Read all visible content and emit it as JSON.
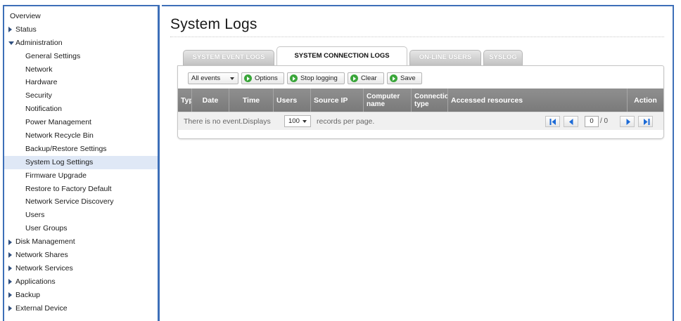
{
  "sidebar": {
    "items": [
      {
        "label": "Overview"
      },
      {
        "label": "Status"
      },
      {
        "label": "Administration"
      },
      {
        "label": "General Settings"
      },
      {
        "label": "Network"
      },
      {
        "label": "Hardware"
      },
      {
        "label": "Security"
      },
      {
        "label": "Notification"
      },
      {
        "label": "Power Management"
      },
      {
        "label": "Network Recycle Bin"
      },
      {
        "label": "Backup/Restore Settings"
      },
      {
        "label": "System Log Settings"
      },
      {
        "label": "Firmware Upgrade"
      },
      {
        "label": "Restore to Factory Default"
      },
      {
        "label": "Network Service Discovery"
      },
      {
        "label": "Users"
      },
      {
        "label": "User Groups"
      },
      {
        "label": "Disk Management"
      },
      {
        "label": "Network Shares"
      },
      {
        "label": "Network Services"
      },
      {
        "label": "Applications"
      },
      {
        "label": "Backup"
      },
      {
        "label": "External Device"
      }
    ],
    "selected": "System Log Settings"
  },
  "main": {
    "title": "System Logs",
    "tabs": [
      {
        "label": "SYSTEM EVENT LOGS"
      },
      {
        "label": "SYSTEM CONNECTION LOGS"
      },
      {
        "label": "ON-LINE USERS"
      },
      {
        "label": "SYSLOG"
      }
    ],
    "active_tab": "SYSTEM CONNECTION LOGS",
    "toolbar": {
      "filter_value": "All events",
      "options_label": "Options",
      "stop_logging_label": "Stop logging",
      "clear_label": "Clear",
      "save_label": "Save"
    },
    "table": {
      "columns": [
        "Type",
        "Date",
        "Time",
        "Users",
        "Source IP",
        "Computer name",
        "Connection type",
        "Accessed resources",
        "Action"
      ]
    },
    "footer": {
      "empty_text": "There is no event.Displays",
      "page_size": "100",
      "records_text": "records per page.",
      "current_page": "0",
      "total_pages": "/ 0"
    }
  },
  "colors": {
    "frame_border": "#3d6fb8",
    "selected_bg": "#dfe8f6",
    "header_bg": "#888888",
    "go_icon": "#3aa63a",
    "pager_icon": "#1c6ad6"
  }
}
